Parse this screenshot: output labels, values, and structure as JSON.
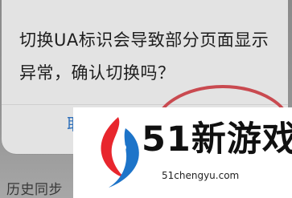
{
  "dialog": {
    "message": "切换UA标识会导致部分页面显示异常，确认切换吗？",
    "cancel_label": "取消"
  },
  "background": {
    "history_sync_label": "历史同步"
  },
  "watermark": {
    "brand": "51新游戏",
    "url": "51chengyu.com",
    "colors": {
      "red": "#e8262d",
      "blue": "#1d74c9"
    }
  },
  "annotation": {
    "circle_color": "#c94a50"
  }
}
